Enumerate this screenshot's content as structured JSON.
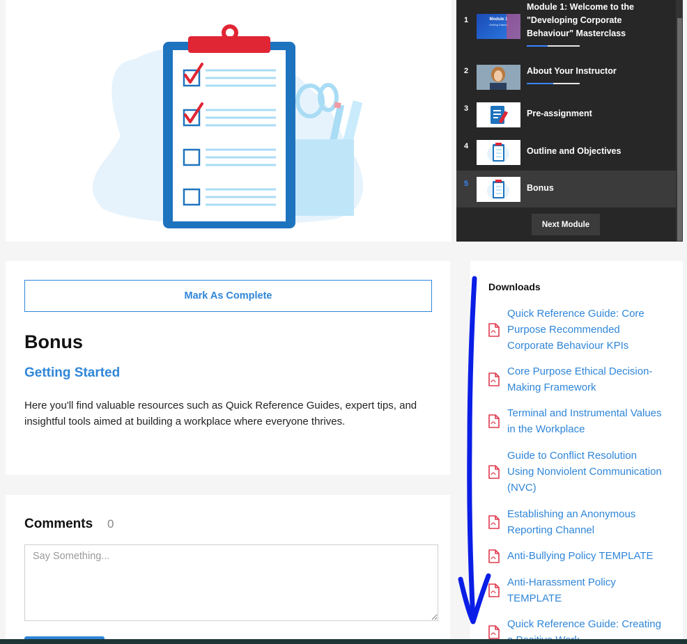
{
  "playlist": {
    "items": [
      {
        "num": "1",
        "title": "Module 1: Welcome to the \"Developing Corporate Behaviour\" Masterclass",
        "progress": 0.4
      },
      {
        "num": "2",
        "title": "About Your Instructor",
        "progress": 0.5
      },
      {
        "num": "3",
        "title": "Pre-assignment"
      },
      {
        "num": "4",
        "title": "Outline and Objectives"
      },
      {
        "num": "5",
        "title": "Bonus",
        "active": true
      }
    ],
    "next_label": "Next Module",
    "thumb1_caption": "Module 1",
    "thumb1_sub": "Getting Started"
  },
  "lesson": {
    "mark_complete_label": "Mark As Complete",
    "title": "Bonus",
    "subtitle": "Getting Started",
    "description": "Here you'll find valuable resources such as Quick Reference Guides, expert tips, and insightful tools aimed at building a workplace where everyone thrives."
  },
  "comments": {
    "label": "Comments",
    "count": "0",
    "placeholder": "Say Something..."
  },
  "downloads": {
    "title": "Downloads",
    "items": [
      {
        "label": "Quick Reference Guide: Core Purpose Recommended Corporate Behaviour KPIs"
      },
      {
        "label": "Core Purpose Ethical Decision-Making Framework"
      },
      {
        "label": "Terminal and Instrumental Values in the Workplace"
      },
      {
        "label": "Guide to Conflict Resolution Using Nonviolent Communication (NVC)"
      },
      {
        "label": "Establishing an Anonymous Reporting Channel"
      },
      {
        "label": "Anti-Bullying Policy TEMPLATE"
      },
      {
        "label": "Anti-Harassment Policy TEMPLATE"
      },
      {
        "label": "Quick Reference Guide: Creating a Positive Work"
      }
    ]
  },
  "colors": {
    "accent": "#2f86d8",
    "playlist_bg": "#272727",
    "pdf_icon": "#e0384b",
    "annotation": "#0a1ee6"
  }
}
